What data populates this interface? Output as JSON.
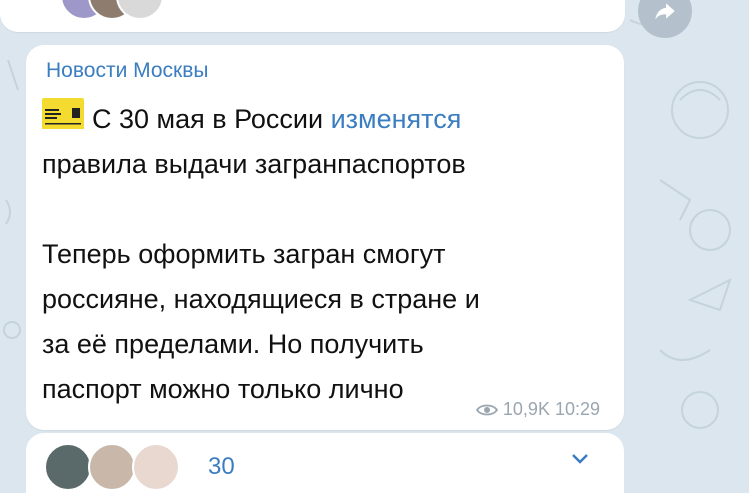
{
  "previous_message": {
    "text": "— ●●●●●●●●●●●●●●●●"
  },
  "post": {
    "channel_name": "Новости Москвы",
    "line1_prefix": "С 30 мая в России ",
    "line1_link": "изменятся",
    "line2": "правила выдачи загранпаспортов",
    "paragraph2_line1": "Теперь оформить загран смогут",
    "paragraph2_line2": "россияне, находящиеся в стране и",
    "paragraph2_line3": "за её пределами. Но получить",
    "paragraph2_line4": "паспорт можно только лично",
    "views": "10,9K",
    "time": "10:29"
  },
  "next_message": {
    "text": "30"
  },
  "icons": {
    "share": "share-icon",
    "views": "eye-icon",
    "sticker": "ticket-sticker-icon",
    "expand": "chevron-down-icon"
  },
  "colors": {
    "background": "#dbe6ee",
    "bubble": "#ffffff",
    "link": "#3a7dc0",
    "meta": "#9aa6b0"
  }
}
